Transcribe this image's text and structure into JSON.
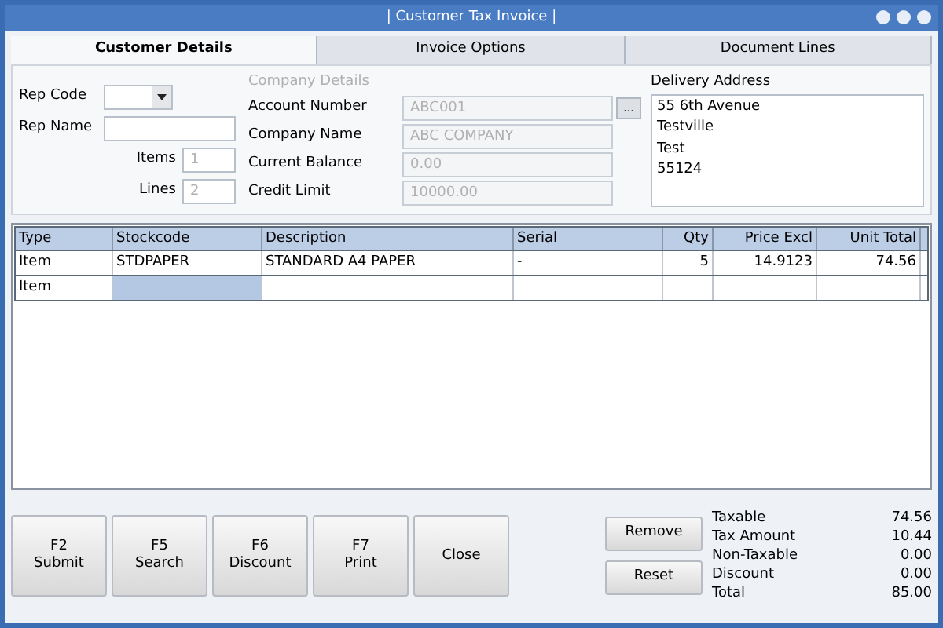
{
  "window": {
    "title": "| Customer Tax Invoice |"
  },
  "tabs": [
    {
      "label": "Customer Details",
      "selected": true
    },
    {
      "label": "Invoice Options",
      "selected": false
    },
    {
      "label": "Document Lines",
      "selected": false
    }
  ],
  "rep": {
    "code_label": "Rep Code",
    "name_label": "Rep Name",
    "items_label": "Items",
    "items_value": "1",
    "lines_label": "Lines",
    "lines_value": "2"
  },
  "company_details": {
    "title": "Company Details",
    "lookup_button": "...",
    "fields": [
      {
        "label": "Account Number",
        "value": "ABC001",
        "disabled": true
      },
      {
        "label": "Company Name",
        "value": "ABC COMPANY",
        "disabled": true
      },
      {
        "label": "Current Balance",
        "value": "0.00",
        "disabled": true
      },
      {
        "label": "Credit Limit",
        "value": "10000.00",
        "disabled": true
      }
    ]
  },
  "delivery_address": {
    "title": "Delivery Address",
    "lines": [
      "55 6th Avenue",
      "Testville",
      "Test",
      "55124"
    ]
  },
  "table": {
    "columns": [
      "Type",
      "Stockcode",
      "Description",
      "Serial",
      "Qty",
      "Price Excl",
      "Unit Total"
    ],
    "rows": [
      {
        "cells": [
          {
            "text": "Item",
            "selected": false
          },
          {
            "text": "STDPAPER",
            "selected": false
          },
          {
            "text": "STANDARD A4 PAPER",
            "selected": false
          },
          {
            "text": "-",
            "selected": false
          },
          {
            "text": "5",
            "selected": false
          },
          {
            "text": "14.9123",
            "selected": false
          },
          {
            "text": "74.56",
            "selected": false
          }
        ]
      },
      {
        "cells": [
          {
            "text": "Item",
            "selected": false
          },
          {
            "selected": true
          },
          {
            "selected": false
          },
          {
            "selected": false
          },
          {
            "selected": false
          },
          {
            "selected": false
          },
          {
            "selected": false
          }
        ]
      }
    ]
  },
  "buttons": [
    {
      "key": "F2",
      "label": "Submit"
    },
    {
      "key": "F5",
      "label": "Search"
    },
    {
      "key": "F6",
      "label": "Discount"
    },
    {
      "key": "F7",
      "label": "Print"
    },
    {
      "label": "Close"
    }
  ],
  "side_buttons": [
    "Remove",
    "Reset"
  ],
  "totals": [
    {
      "label": "Taxable",
      "value": "74.56"
    },
    {
      "label": "Tax Amount",
      "value": "10.44"
    },
    {
      "label": "Non-Taxable",
      "value": "0.00"
    },
    {
      "label": "Discount",
      "value": "0.00"
    },
    {
      "label": "Total",
      "value": "85.00"
    }
  ]
}
